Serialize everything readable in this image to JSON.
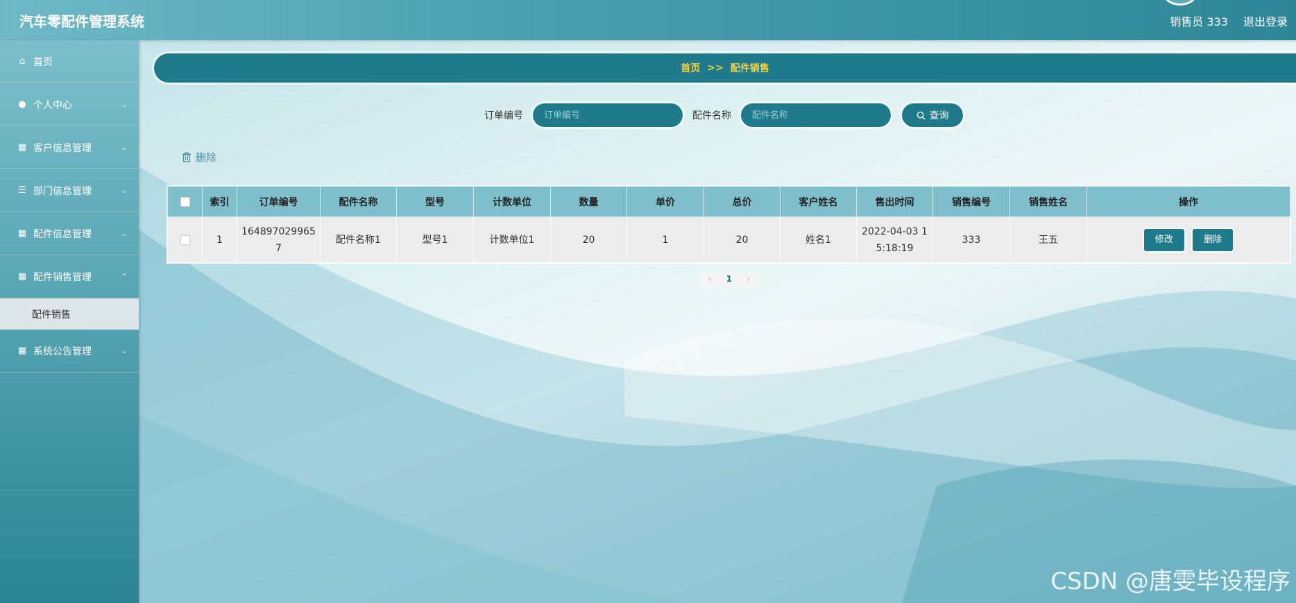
{
  "app": {
    "title": "汽车零配件管理系统"
  },
  "header": {
    "user_label": "销售员 333",
    "logout_label": "退出登录"
  },
  "sidebar": {
    "items": [
      {
        "label": "首页",
        "icon": "home-icon",
        "glyph": "⌂"
      },
      {
        "label": "个人中心",
        "icon": "user-icon",
        "glyph": "●"
      },
      {
        "label": "客户信息管理",
        "icon": "grid-icon",
        "glyph": "▦"
      },
      {
        "label": "部门信息管理",
        "icon": "list-icon",
        "glyph": "☰"
      },
      {
        "label": "配件信息管理",
        "icon": "grid-icon",
        "glyph": "▦"
      },
      {
        "label": "配件销售管理",
        "icon": "grid-icon",
        "glyph": "▦"
      }
    ],
    "sub_item": "配件销售",
    "last_item": {
      "label": "系统公告管理",
      "icon": "apps-icon",
      "glyph": "▦"
    }
  },
  "breadcrumb": {
    "home": "首页",
    "sep": ">>",
    "current": "配件销售"
  },
  "search": {
    "order_label": "订单编号",
    "order_placeholder": "订单编号",
    "part_label": "配件名称",
    "part_placeholder": "配件名称",
    "button_label": "查询"
  },
  "actions": {
    "delete_label": "删除"
  },
  "table": {
    "headers": [
      "索引",
      "订单编号",
      "配件名称",
      "型号",
      "计数单位",
      "数量",
      "单价",
      "总价",
      "客户姓名",
      "售出时间",
      "销售编号",
      "销售姓名",
      "操作"
    ],
    "rows": [
      {
        "index": "1",
        "order_no": "1648970299657",
        "part_name": "配件名称1",
        "model": "型号1",
        "unit": "计数单位1",
        "qty": "20",
        "price": "1",
        "total": "20",
        "customer": "姓名1",
        "sold_time": "2022-04-03 15:18:19",
        "sales_no": "333",
        "sales_name": "王五",
        "edit_label": "修改",
        "delete_label": "删除"
      }
    ]
  },
  "pagination": {
    "prev": "‹",
    "current": "1",
    "next": "›"
  },
  "watermark": "CSDN @唐雯毕设程序",
  "colors": {
    "primary": "#1f7b8c",
    "breadcrumb_text": "#f5d142",
    "header_row": "#7fbfcc"
  }
}
